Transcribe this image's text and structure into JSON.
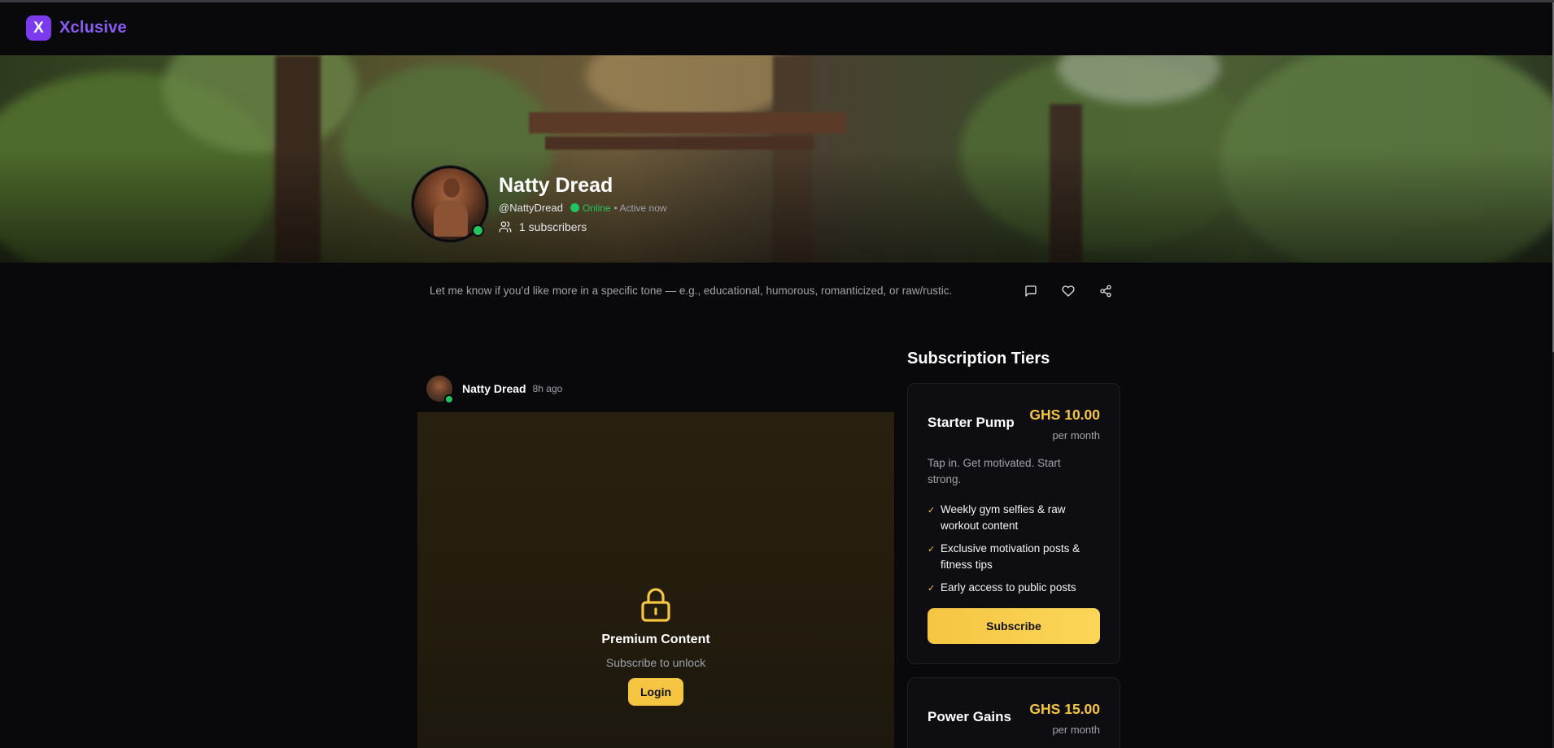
{
  "app": {
    "logo_letter": "X",
    "name": "Xclusive",
    "brand_color": "#7c3aed"
  },
  "profile": {
    "name": "Natty Dread",
    "handle": "@NattyDread",
    "status": "Online",
    "active": "• Active now",
    "subscribers": "1 subscribers",
    "bio": "Let me know if you’d like more in a specific tone — e.g., educational, humorous, romanticized, or raw/rustic.",
    "actions": [
      "message-icon",
      "heart-icon",
      "share-icon"
    ]
  },
  "post": {
    "author": "Natty Dread",
    "time": "8h ago",
    "locked_title": "Premium Content",
    "locked_subtitle": "Subscribe to unlock",
    "login_label": "Login"
  },
  "tiers": {
    "title": "Subscription Tiers",
    "items": [
      {
        "name": "Starter Pump",
        "price": "GHS 10.00",
        "period": "per month",
        "description": "Tap in. Get motivated. Start strong.",
        "benefits": [
          "Weekly gym selfies & raw workout content",
          "Exclusive motivation posts & fitness tips",
          "Early access to public posts"
        ],
        "button": "Subscribe"
      },
      {
        "name": "Power Gains",
        "price": "GHS 15.00",
        "period": "per month"
      }
    ]
  },
  "colors": {
    "accent": "#f5c542",
    "online": "#22c55e",
    "background": "#09090c"
  }
}
